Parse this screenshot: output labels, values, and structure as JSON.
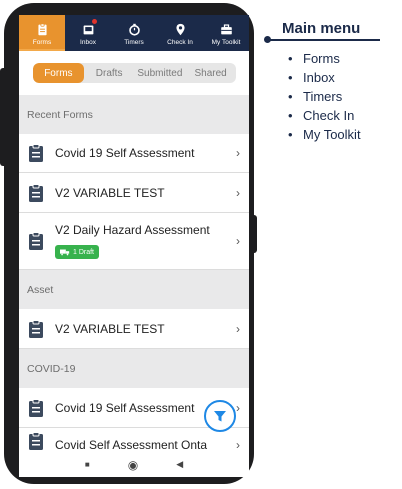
{
  "topnav": {
    "items": [
      {
        "label": "Forms",
        "icon": "clipboard-icon",
        "active": true
      },
      {
        "label": "Inbox",
        "icon": "inbox-icon",
        "notification": true
      },
      {
        "label": "Timers",
        "icon": "stopwatch-icon"
      },
      {
        "label": "Check In",
        "icon": "location-pin-icon"
      },
      {
        "label": "My Toolkit",
        "icon": "toolbox-icon"
      }
    ]
  },
  "tabs": [
    "Forms",
    "Drafts",
    "Submitted",
    "Shared"
  ],
  "sections": {
    "recent": "Recent Forms",
    "asset": "Asset",
    "covid": "COVID-19"
  },
  "rows": [
    {
      "title": "Covid 19 Self Assessment"
    },
    {
      "title": "V2 VARIABLE TEST"
    },
    {
      "title": "V2 Daily Hazard Assessment",
      "badge": "1 Draft"
    },
    {
      "title": "V2 VARIABLE TEST"
    },
    {
      "title": "Covid 19 Self Assessment"
    },
    {
      "title": "Covid Self Assessment Onta"
    }
  ],
  "legend": {
    "title": "Main menu",
    "items": [
      "Forms",
      "Inbox",
      "Timers",
      "Check In",
      "My Toolkit"
    ]
  },
  "colors": {
    "nav_bg": "#1b2a49",
    "accent": "#e8932e",
    "badge": "#37b24d",
    "fab_border": "#1e88e5"
  }
}
